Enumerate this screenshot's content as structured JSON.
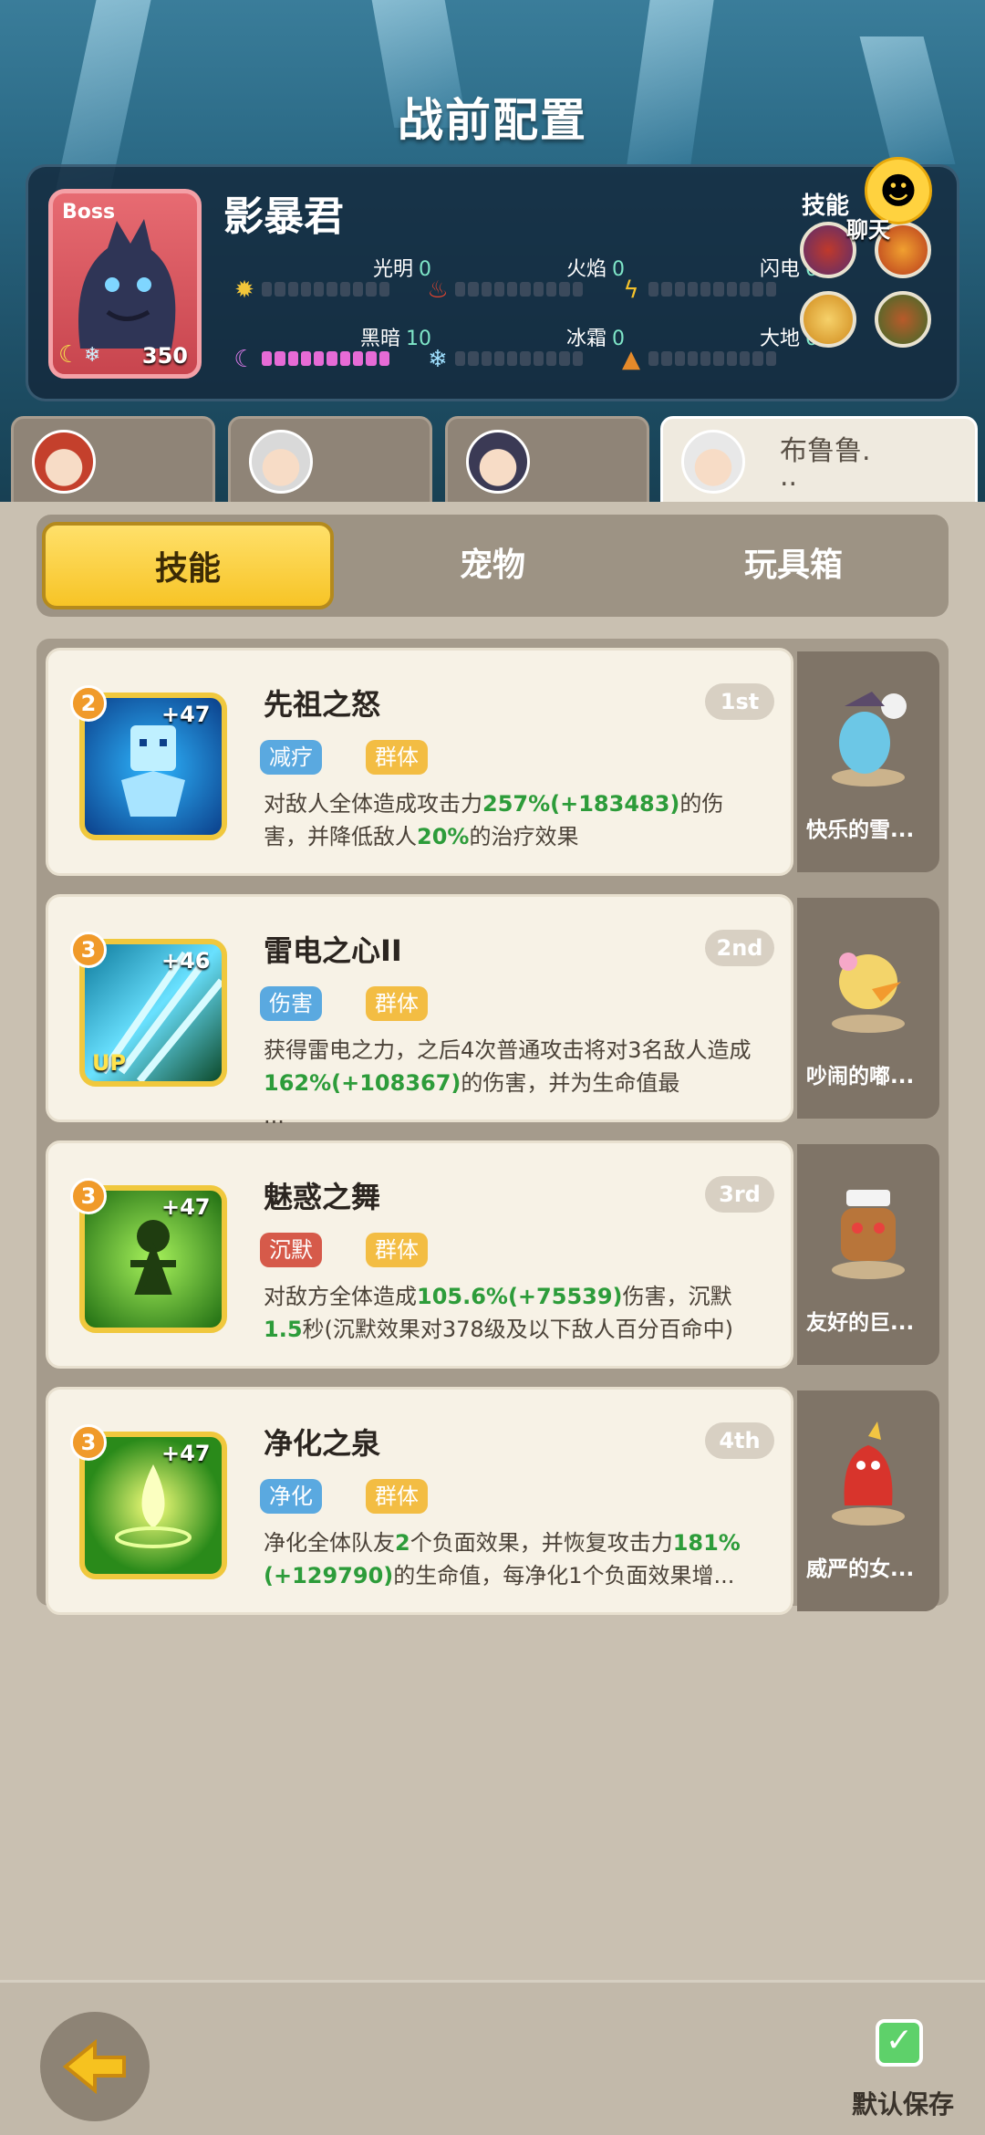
{
  "page_title": "战前配置",
  "boss": {
    "tag": "Boss",
    "name": "影暴君",
    "level": "350",
    "elements": [
      {
        "label": "光明",
        "value": "0",
        "icon": "sun-icon",
        "fill": 0
      },
      {
        "label": "火焰",
        "value": "0",
        "icon": "flame-icon",
        "fill": 0
      },
      {
        "label": "闪电",
        "value": "0",
        "icon": "lightning-icon",
        "fill": 0
      },
      {
        "label": "黑暗",
        "value": "10",
        "icon": "moon-icon",
        "fill": 10
      },
      {
        "label": "冰霜",
        "value": "0",
        "icon": "snowflake-icon",
        "fill": 0
      },
      {
        "label": "大地",
        "value": "0",
        "icon": "mountain-icon",
        "fill": 0
      }
    ],
    "skills_label": "技能",
    "chat_label": "聊天"
  },
  "hero_tabs": [
    {
      "name": "",
      "active": false
    },
    {
      "name": "",
      "active": false
    },
    {
      "name": "",
      "active": false
    },
    {
      "name": "布鲁鲁.",
      "sub": "..",
      "active": true
    }
  ],
  "tabs": {
    "skills": "技能",
    "pets": "宠物",
    "toybox": "玩具箱"
  },
  "cards": [
    {
      "level": "2",
      "plus": "+47",
      "title": "先祖之怒",
      "rank": "1st",
      "tag1": "减疗",
      "tag1_color": "#5aa9e0",
      "tag2": "群体",
      "desc": [
        "对敌人全体造成攻击力",
        "257%(+183483)",
        "的伤害，并降低敌人",
        "20%",
        "的治疗效果"
      ],
      "pet": "快乐的雪..."
    },
    {
      "level": "3",
      "plus": "+46",
      "up": "UP",
      "title": "雷电之心II",
      "rank": "2nd",
      "tag1": "伤害",
      "tag1_color": "#5aa9e0",
      "tag2": "群体",
      "desc": [
        "获得雷电之力，之后4次普通攻击将对3名敌人造成",
        "162%(+108367)",
        "的伤害，并为生命值最",
        "",
        "..."
      ],
      "pet": "吵闹的嘟..."
    },
    {
      "level": "3",
      "plus": "+47",
      "title": "魅惑之舞",
      "rank": "3rd",
      "tag1": "沉默",
      "tag1_color": "#d65a4a",
      "tag2": "群体",
      "desc": [
        "对敌方全体造成",
        "105.6%(+75539)",
        "伤害，沉默",
        "1.5",
        "秒(沉默效果对378级及以下敌人百分百命中)"
      ],
      "pet": "友好的巨..."
    },
    {
      "level": "3",
      "plus": "+47",
      "title": "净化之泉",
      "rank": "4th",
      "tag1": "净化",
      "tag1_color": "#5aa9e0",
      "tag2": "群体",
      "desc": [
        "净化全体队友",
        "2",
        "个负面效果，并恢复攻击力",
        "181%(+129790)",
        "的生命值，每净化1个负面效果增..."
      ],
      "pet": "威严的女..."
    }
  ],
  "footer": {
    "save_label": "默认保存"
  }
}
